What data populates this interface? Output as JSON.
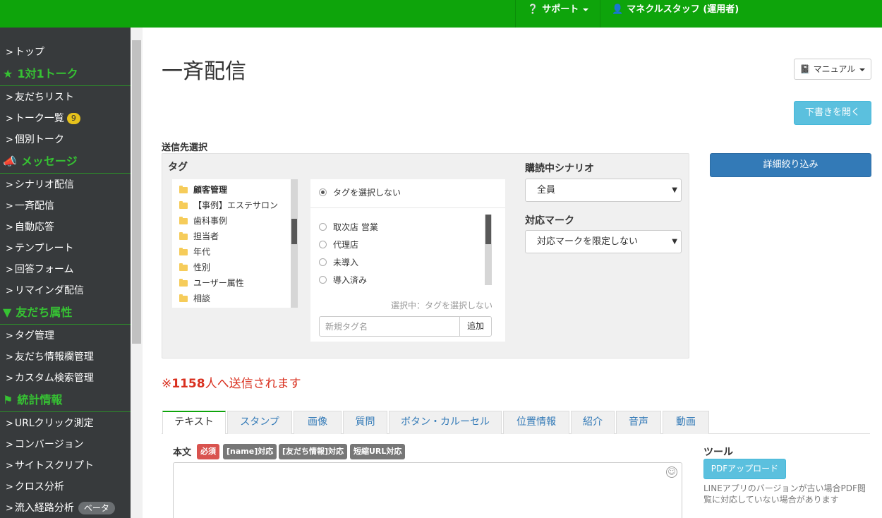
{
  "topbar": {
    "support_label": "サポート",
    "user_label": "マネクルスタッフ (運用者)"
  },
  "sidebar": {
    "top": "トップ",
    "section_talk": "1対1トーク",
    "friend_list": "友だちリスト",
    "talk_list": "トーク一覧",
    "talk_badge": "9",
    "individual_talk": "個別トーク",
    "section_message": "メッセージ",
    "scenario": "シナリオ配信",
    "broadcast": "一斉配信",
    "auto_reply": "自動応答",
    "template": "テンプレート",
    "answer_form": "回答フォーム",
    "reminder": "リマインダ配信",
    "section_attr": "友だち属性",
    "tag_manage": "タグ管理",
    "friend_info": "友だち情報欄管理",
    "custom_search": "カスタム検索管理",
    "section_stats": "統計情報",
    "url_click": "URLクリック測定",
    "conversion": "コンバージョン",
    "site_script": "サイトスクリプト",
    "cross": "クロス分析",
    "inflow": "流入経路分析",
    "inflow_badge": "ベータ"
  },
  "main": {
    "title": "一斉配信",
    "manual_label": "マニュアル",
    "draft_label": "下書きを開く",
    "detail_label": "詳細絞り込み",
    "dest_label": "送信先選択",
    "tag_label": "タグ",
    "folders": [
      "顧客管理",
      "【事例】エステサロン",
      "歯科事例",
      "担当者",
      "年代",
      "性別",
      "ユーザー属性",
      "相談"
    ],
    "no_tag": "タグを選択しない",
    "tags": [
      "取次店 営業",
      "代理店",
      "未導入",
      "導入済み"
    ],
    "selected_info": "選択中：タグを選択しない",
    "new_tag_placeholder": "新規タグ名",
    "add_label": "追加",
    "scenario_label": "購読中シナリオ",
    "scenario_value": "全員",
    "mark_label": "対応マーク",
    "mark_value": "対応マークを限定しない",
    "count_prefix": "※",
    "count": "1158",
    "count_suffix": "人へ送信されます",
    "tabs": [
      "テキスト",
      "スタンプ",
      "画像",
      "質問",
      "ボタン・カルーセル",
      "位置情報",
      "紹介",
      "音声",
      "動画"
    ],
    "body_label": "本文",
    "pills": [
      "必須",
      "[name]対応",
      "[友だち情報]対応",
      "短縮URL対応"
    ],
    "tools_label": "ツール",
    "pdf_label": "PDFアップロード",
    "pdf_note": "LINEアプリのバージョンが古い場合PDF閲覧に対応していない場合があります"
  },
  "colors": {
    "brand_green": "#0ea40b",
    "info": "#5bc0de",
    "primary": "#337ab7",
    "danger": "#d9301f"
  }
}
